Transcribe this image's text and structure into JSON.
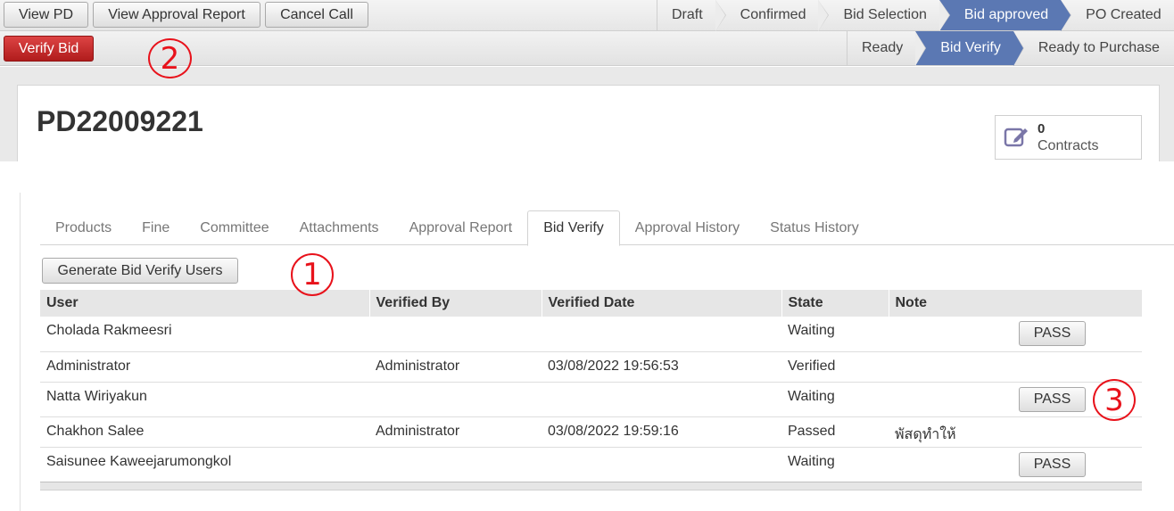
{
  "toolbar": {
    "view_pd": "View PD",
    "view_approval_report": "View Approval Report",
    "cancel_call": "Cancel Call",
    "verify_bid": "Verify Bid"
  },
  "status_steps": [
    "Draft",
    "Confirmed",
    "Bid Selection",
    "Bid approved",
    "PO Created"
  ],
  "status_active": "Bid approved",
  "verify_steps": [
    "Ready",
    "Bid Verify",
    "Ready to Purchase"
  ],
  "verify_active": "Bid Verify",
  "record": {
    "title": "PD22009221",
    "contracts_count": "0",
    "contracts_label": "Contracts"
  },
  "tabs": [
    "Products",
    "Fine",
    "Committee",
    "Attachments",
    "Approval Report",
    "Bid Verify",
    "Approval History",
    "Status History"
  ],
  "active_tab": "Bid Verify",
  "generate_button": "Generate Bid Verify Users",
  "table": {
    "columns": [
      "User",
      "Verified By",
      "Verified Date",
      "State",
      "Note"
    ],
    "rows": [
      {
        "user": "Cholada Rakmeesri",
        "verified_by": "",
        "verified_date": "",
        "state": "Waiting",
        "note": "",
        "action": "PASS"
      },
      {
        "user": "Administrator",
        "verified_by": "Administrator",
        "verified_date": "03/08/2022 19:56:53",
        "state": "Verified",
        "note": "",
        "action": ""
      },
      {
        "user": "Natta Wiriyakun",
        "verified_by": "",
        "verified_date": "",
        "state": "Waiting",
        "note": "",
        "action": "PASS"
      },
      {
        "user": "Chakhon Salee",
        "verified_by": "Administrator",
        "verified_date": "03/08/2022 19:59:16",
        "state": "Passed",
        "note": "พัสดุทำให้",
        "action": ""
      },
      {
        "user": "Saisunee Kaweejarumongkol",
        "verified_by": "",
        "verified_date": "",
        "state": "Waiting",
        "note": "",
        "action": "PASS"
      }
    ]
  },
  "callouts": [
    "1",
    "2",
    "3"
  ],
  "colors": {
    "active_step": "#5b78b3",
    "verify_button": "#c22525",
    "callout": "#e8121b"
  }
}
